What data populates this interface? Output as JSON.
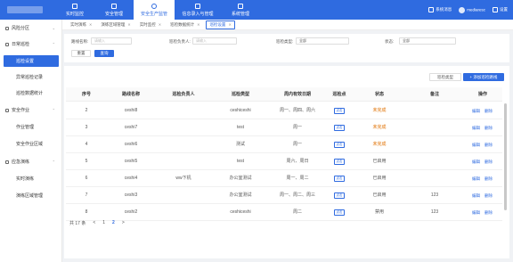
{
  "topnav": {
    "items": [
      {
        "label": "实时监控",
        "active": false
      },
      {
        "label": "安全管理",
        "active": false
      },
      {
        "label": "安全生产监管",
        "active": true
      },
      {
        "label": "信息录入与管理",
        "active": false
      },
      {
        "label": "系统管理",
        "active": false
      }
    ],
    "user1": "系统消息",
    "user2": "mediaresc",
    "settings": "设置"
  },
  "sidebar": {
    "groups": [
      {
        "label": "风险分区",
        "chevron": "⌄"
      },
      {
        "label": "日常巡检",
        "chevron": "⌃"
      },
      {
        "label": "安全作业",
        "chevron": "⌃"
      },
      {
        "label": "应急演练",
        "chevron": "⌃"
      }
    ],
    "items": [
      {
        "label": "巡检设置",
        "active": true
      },
      {
        "label": "异常巡检记录",
        "active": false
      },
      {
        "label": "巡检数据统计",
        "active": false
      },
      {
        "label": "作业管理",
        "active": false
      },
      {
        "label": "安全作业区域",
        "active": false
      },
      {
        "label": "实时演练",
        "active": false
      },
      {
        "label": "演练区域管理",
        "active": false
      }
    ]
  },
  "tabs": [
    {
      "label": "实时演练",
      "active": false
    },
    {
      "label": "演练区域管理",
      "active": false
    },
    {
      "label": "实时监控",
      "active": false
    },
    {
      "label": "巡检数据统计",
      "active": false
    },
    {
      "label": "巡检设置",
      "active": true
    }
  ],
  "filter": {
    "area_name_label": "路线名称:",
    "area_name_placeholder": "请输入",
    "person_label": "巡检负责人:",
    "person_placeholder": "请输入",
    "type_label": "巡检类型:",
    "type_value": "全部",
    "status_label": "状态:",
    "status_value": "全部",
    "reset": "重置",
    "search": "查询"
  },
  "toolbar": {
    "add_type": "巡检类型",
    "add_area": "+ 添加巡检路线"
  },
  "table": {
    "headers": [
      "序号",
      "路线名称",
      "巡检负责人",
      "巡检类型",
      "周内有效日期",
      "巡检点",
      "状态",
      "备注",
      "操作"
    ],
    "rows": [
      {
        "no": "2",
        "name": "ceshi8",
        "person": "",
        "type": "ceshiceshi",
        "days": "周一、周四、周六",
        "point": "点击",
        "status": "未完成",
        "status_kind": "todo",
        "remark": "",
        "op1": "编辑",
        "op2": "删除"
      },
      {
        "no": "3",
        "name": "ceshi7",
        "person": "",
        "type": "test",
        "days": "周一",
        "point": "点击",
        "status": "未完成",
        "status_kind": "todo",
        "remark": "",
        "op1": "编辑",
        "op2": "删除"
      },
      {
        "no": "4",
        "name": "ceshi6",
        "person": "",
        "type": "测试",
        "days": "周一",
        "point": "点击",
        "status": "未完成",
        "status_kind": "todo",
        "remark": "",
        "op1": "编辑",
        "op2": "删除"
      },
      {
        "no": "5",
        "name": "ceshi5",
        "person": "",
        "type": "test",
        "days": "周六、周日",
        "point": "点击",
        "status": "已启用",
        "status_kind": "done",
        "remark": "",
        "op1": "编辑",
        "op2": "删除"
      },
      {
        "no": "6",
        "name": "ceshi4",
        "person": "ww下机",
        "type": "办公室测试",
        "days": "周一、周二",
        "point": "点击",
        "status": "已启用",
        "status_kind": "done",
        "remark": "",
        "op1": "编辑",
        "op2": "删除"
      },
      {
        "no": "7",
        "name": "ceshi3",
        "person": "",
        "type": "办公室测试",
        "days": "周一、周二、周三",
        "point": "点击",
        "status": "已启用",
        "status_kind": "done",
        "remark": "123",
        "op1": "编辑",
        "op2": "删除"
      },
      {
        "no": "8",
        "name": "ceshi2",
        "person": "",
        "type": "ceshiceshi",
        "days": "周二",
        "point": "点击",
        "status": "禁用",
        "status_kind": "done",
        "remark": "123",
        "op1": "编辑",
        "op2": "删除"
      }
    ]
  },
  "pager": {
    "total": "共 17 条",
    "prev": "<",
    "page1": "1",
    "page2": "2",
    "next": ">"
  }
}
